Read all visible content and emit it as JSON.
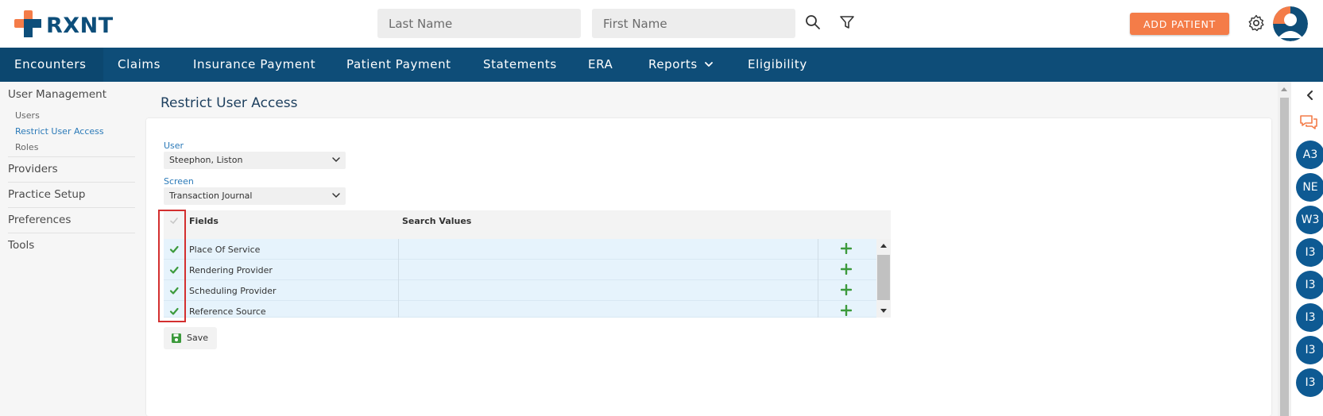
{
  "header": {
    "logo_text": "RXNT",
    "last_name_placeholder": "Last Name",
    "first_name_placeholder": "First Name",
    "add_patient_label": "ADD PATIENT"
  },
  "nav": {
    "items": [
      "Encounters",
      "Claims",
      "Insurance Payment",
      "Patient Payment",
      "Statements",
      "ERA",
      "Reports",
      "Eligibility"
    ]
  },
  "sidebar": {
    "user_management": "User Management",
    "sub_items": [
      "Users",
      "Restrict User Access",
      "Roles"
    ],
    "sections": [
      "Providers",
      "Practice Setup",
      "Preferences",
      "Tools"
    ]
  },
  "page": {
    "title": "Restrict User Access",
    "user_label": "User",
    "user_value": "Steephon, Liston",
    "screen_label": "Screen",
    "screen_value": "Transaction Journal"
  },
  "grid": {
    "col_fields": "Fields",
    "col_search": "Search Values",
    "rows": [
      "Place Of Service",
      "Rendering Provider",
      "Scheduling Provider",
      "Reference Source"
    ]
  },
  "save_label": "Save",
  "rightbar": {
    "bubbles": [
      "A3",
      "NE",
      "W3",
      "I3",
      "I3",
      "I3",
      "I3",
      "I3"
    ]
  },
  "colors": {
    "nav_bg": "#0e4d78",
    "accent_orange": "#f47c48",
    "link_blue": "#2b7ab8",
    "check_green": "#3c9a3c",
    "highlight_red": "#d32f2f"
  }
}
